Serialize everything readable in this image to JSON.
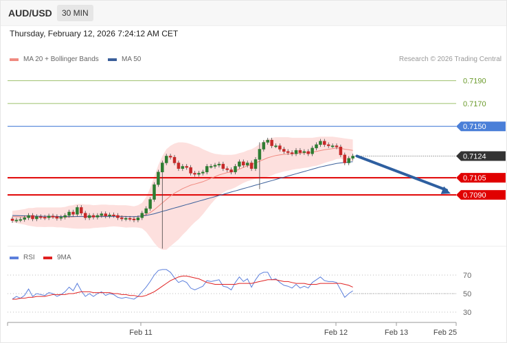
{
  "header": {
    "pair": "AUD/USD",
    "timeframe": "30 MIN"
  },
  "timestamp": "Thursday, February 12, 2026 7:24:12 AM CET",
  "main_legend": [
    {
      "label": "MA 20 + Bollinger Bands",
      "color": "#f08a80"
    },
    {
      "label": "MA 50",
      "color": "#3a5f9a"
    }
  ],
  "credit": "Research © 2026 Trading Central",
  "rsi_legend": [
    {
      "label": "RSI",
      "color": "#5b7fdc"
    },
    {
      "label": "9MA",
      "color": "#e02020"
    }
  ],
  "colors": {
    "up": "#2e7d32",
    "down": "#c62828",
    "resistance_line": "#e00000",
    "band_fill": "#fde0de",
    "ma20": "#f08a80",
    "ma50": "#3a5f9a",
    "target_line": "#9bc06a",
    "pivot_line": "#4a7fd8",
    "arrow": "#2e5fa0"
  },
  "chart_data": [
    {
      "type": "candlestick",
      "series_name": "AUD/USD",
      "ylim": [
        0.7045,
        0.7215
      ],
      "price_levels": [
        {
          "price": 0.719,
          "label": "0.7190",
          "kind": "target"
        },
        {
          "price": 0.717,
          "label": "0.7170",
          "kind": "target"
        },
        {
          "price": 0.715,
          "label": "0.7150",
          "kind": "pivot"
        },
        {
          "price": 0.7124,
          "label": "0.7124",
          "kind": "last"
        },
        {
          "price": 0.7105,
          "label": "0.7105",
          "kind": "support"
        },
        {
          "price": 0.709,
          "label": "0.7090",
          "kind": "support"
        }
      ],
      "x_ticks": [
        "Feb 11",
        "Feb 12",
        "Feb 13",
        "Feb 25"
      ],
      "forecast": {
        "from": 0.7124,
        "to": 0.709,
        "direction": "down"
      },
      "closes": [
        0.70675,
        0.7068,
        0.70685,
        0.707,
        0.7072,
        0.7069,
        0.7071,
        0.70705,
        0.707,
        0.70715,
        0.7071,
        0.70695,
        0.70705,
        0.7072,
        0.7075,
        0.7073,
        0.7079,
        0.7074,
        0.707,
        0.7072,
        0.70705,
        0.7072,
        0.70735,
        0.70715,
        0.70725,
        0.7072,
        0.707,
        0.7069,
        0.70695,
        0.7069,
        0.7068,
        0.707,
        0.7074,
        0.7078,
        0.7086,
        0.7099,
        0.711,
        0.7118,
        0.7124,
        0.7123,
        0.7118,
        0.7113,
        0.7115,
        0.7114,
        0.7109,
        0.7108,
        0.7109,
        0.711,
        0.7115,
        0.7115,
        0.7116,
        0.7117,
        0.7113,
        0.7112,
        0.711,
        0.7115,
        0.7119,
        0.7116,
        0.7118,
        0.7113,
        0.7121,
        0.713,
        0.7136,
        0.7138,
        0.7133,
        0.7133,
        0.713,
        0.7128,
        0.7127,
        0.7126,
        0.7129,
        0.7127,
        0.7128,
        0.7126,
        0.7131,
        0.7134,
        0.7137,
        0.7134,
        0.7133,
        0.7133,
        0.7132,
        0.7125,
        0.7118,
        0.7122,
        0.7124
      ],
      "ma20": [
        0.7071,
        0.7071,
        0.70708,
        0.70708,
        0.70708,
        0.70706,
        0.70706,
        0.70705,
        0.70704,
        0.70705,
        0.70705,
        0.70703,
        0.70703,
        0.70704,
        0.70707,
        0.70708,
        0.70712,
        0.70712,
        0.7071,
        0.7071,
        0.7071,
        0.70712,
        0.70715,
        0.70716,
        0.70717,
        0.70718,
        0.70716,
        0.70714,
        0.70712,
        0.7071,
        0.70708,
        0.70712,
        0.70718,
        0.70728,
        0.70745,
        0.7077,
        0.708,
        0.7083,
        0.7086,
        0.7089,
        0.70915,
        0.70935,
        0.70955,
        0.7097,
        0.70985,
        0.70995,
        0.71005,
        0.71015,
        0.7103,
        0.71045,
        0.7106,
        0.71075,
        0.71085,
        0.71095,
        0.711,
        0.7111,
        0.71125,
        0.7114,
        0.71155,
        0.71165,
        0.7118,
        0.71195,
        0.7121,
        0.71225,
        0.71235,
        0.71245,
        0.7125,
        0.71255,
        0.71258,
        0.7126,
        0.71263,
        0.71265,
        0.71268,
        0.7127,
        0.71275,
        0.7128,
        0.71288,
        0.71295,
        0.713,
        0.71305,
        0.7131,
        0.71308,
        0.713,
        0.71295,
        0.7129
      ],
      "bb_upper": [
        0.7076,
        0.70765,
        0.7077,
        0.70775,
        0.70785,
        0.70785,
        0.7079,
        0.7079,
        0.7079,
        0.7079,
        0.7079,
        0.7079,
        0.7079,
        0.70795,
        0.70805,
        0.7081,
        0.7082,
        0.7082,
        0.70815,
        0.70815,
        0.7081,
        0.70812,
        0.70815,
        0.70815,
        0.70812,
        0.70812,
        0.7081,
        0.7081,
        0.7081,
        0.70805,
        0.708,
        0.7081,
        0.7083,
        0.7088,
        0.7096,
        0.7106,
        0.7116,
        0.7124,
        0.713,
        0.7133,
        0.7135,
        0.7136,
        0.7136,
        0.71355,
        0.71345,
        0.7133,
        0.7132,
        0.713,
        0.71285,
        0.7127,
        0.7126,
        0.71255,
        0.7125,
        0.7125,
        0.7125,
        0.71255,
        0.71265,
        0.71275,
        0.7129,
        0.713,
        0.7132,
        0.71345,
        0.7137,
        0.7139,
        0.714,
        0.71405,
        0.71405,
        0.71405,
        0.71405,
        0.714,
        0.714,
        0.714,
        0.714,
        0.714,
        0.714,
        0.71405,
        0.7141,
        0.7141,
        0.7141,
        0.7141,
        0.71405,
        0.714,
        0.71395,
        0.7139,
        0.71385
      ],
      "bb_lower": [
        0.7066,
        0.70655,
        0.70645,
        0.7064,
        0.7063,
        0.70625,
        0.7062,
        0.7062,
        0.70618,
        0.7062,
        0.7062,
        0.70616,
        0.70616,
        0.70613,
        0.70609,
        0.70606,
        0.70604,
        0.70604,
        0.70605,
        0.70605,
        0.7061,
        0.70612,
        0.70615,
        0.70617,
        0.70622,
        0.70624,
        0.70622,
        0.70618,
        0.70614,
        0.70615,
        0.70616,
        0.70614,
        0.70606,
        0.70576,
        0.7053,
        0.7048,
        0.7044,
        0.7042,
        0.7042,
        0.7045,
        0.7048,
        0.7051,
        0.7055,
        0.70585,
        0.70625,
        0.7066,
        0.7069,
        0.7073,
        0.70775,
        0.7082,
        0.7086,
        0.70895,
        0.7092,
        0.7094,
        0.7095,
        0.70965,
        0.70985,
        0.71005,
        0.7102,
        0.7103,
        0.7104,
        0.71045,
        0.7105,
        0.7106,
        0.7107,
        0.71085,
        0.71095,
        0.71105,
        0.71111,
        0.7112,
        0.71126,
        0.7113,
        0.71136,
        0.7114,
        0.7115,
        0.71155,
        0.71166,
        0.7118,
        0.7119,
        0.712,
        0.71215,
        0.71216,
        0.71205,
        0.712,
        0.71195
      ],
      "ma50": [
        0.7072,
        0.70719,
        0.70718,
        0.70717,
        0.70716,
        0.70715,
        0.70714,
        0.70714,
        0.70713,
        0.70713,
        0.70712,
        0.70712,
        0.70711,
        0.70711,
        0.70711,
        0.70711,
        0.70711,
        0.70711,
        0.70711,
        0.70711,
        0.70711,
        0.70711,
        0.70711,
        0.70711,
        0.70711,
        0.70711,
        0.7071,
        0.7071,
        0.7071,
        0.7071,
        0.7071,
        0.70712,
        0.70715,
        0.7072,
        0.70727,
        0.70735,
        0.70745,
        0.70755,
        0.70765,
        0.70775,
        0.70785,
        0.70795,
        0.70805,
        0.70815,
        0.70825,
        0.70835,
        0.70845,
        0.70855,
        0.70865,
        0.70875,
        0.70885,
        0.70895,
        0.70905,
        0.70915,
        0.70925,
        0.70935,
        0.70945,
        0.70955,
        0.70965,
        0.70975,
        0.70985,
        0.70995,
        0.71005,
        0.71015,
        0.71025,
        0.71035,
        0.71045,
        0.71055,
        0.71065,
        0.71075,
        0.71085,
        0.71095,
        0.71105,
        0.71115,
        0.71125,
        0.71135,
        0.71145,
        0.71152,
        0.7116,
        0.71168,
        0.71175,
        0.7118,
        0.71184,
        0.71187,
        0.7119
      ]
    },
    {
      "type": "line",
      "series_name": "RSI",
      "ylim": [
        25,
        80
      ],
      "y_ticks": [
        30,
        50,
        70
      ],
      "x_ticks": [
        "Feb 11",
        "Feb 12",
        "Feb 13",
        "Feb 25"
      ],
      "series": [
        {
          "name": "RSI",
          "values": [
            44,
            47,
            45,
            48,
            55,
            47,
            50,
            49,
            48,
            51,
            50,
            47,
            49,
            52,
            57,
            53,
            61,
            53,
            47,
            50,
            47,
            50,
            52,
            48,
            50,
            49,
            46,
            45,
            46,
            45,
            44,
            47,
            52,
            57,
            63,
            70,
            75,
            76,
            76,
            73,
            67,
            62,
            64,
            62,
            56,
            54,
            56,
            58,
            64,
            63,
            64,
            65,
            58,
            57,
            54,
            62,
            68,
            63,
            66,
            57,
            65,
            71,
            73,
            73,
            65,
            66,
            62,
            59,
            58,
            56,
            60,
            56,
            58,
            56,
            62,
            65,
            68,
            64,
            63,
            63,
            62,
            54,
            46,
            50,
            53
          ]
        },
        {
          "name": "9MA",
          "values": [
            44,
            44,
            45,
            45,
            46,
            46,
            47,
            47,
            47,
            48,
            49,
            49,
            49,
            49,
            50,
            50,
            51,
            52,
            52,
            52,
            51,
            51,
            51,
            51,
            51,
            50,
            50,
            49,
            49,
            48,
            48,
            47,
            47,
            48,
            50,
            52,
            55,
            58,
            61,
            64,
            66,
            68,
            69,
            69,
            68,
            67,
            66,
            64,
            62,
            61,
            60,
            60,
            60,
            60,
            60,
            60,
            61,
            61,
            61,
            61,
            62,
            63,
            64,
            65,
            65,
            65,
            64,
            63,
            63,
            62,
            61,
            61,
            61,
            60,
            60,
            60,
            61,
            61,
            61,
            61,
            61,
            61,
            60,
            59,
            57
          ]
        }
      ]
    }
  ]
}
